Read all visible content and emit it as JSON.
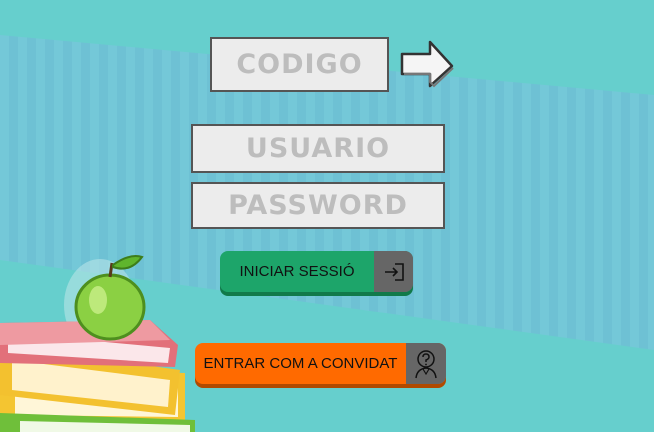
{
  "colors": {
    "background": "#6acfcf",
    "stripe": "#72c3d6",
    "field_bg": "#ececec",
    "login_green": "#1da56a",
    "guest_orange": "#ff6a00",
    "icon_gray": "#666666"
  },
  "form": {
    "codigo_placeholder": "CODIGO",
    "usuario_placeholder": "USUARIO",
    "password_placeholder": "PASSWORD"
  },
  "buttons": {
    "login_label": "INICIAR SESSIÓ",
    "login_icon": "login-icon",
    "guest_label": "ENTRAR COM A CONVIDAT",
    "guest_icon": "guest-question-icon",
    "code_submit_icon": "arrow-right-icon"
  },
  "decoration": {
    "illustration": "books-and-apple-illustration"
  }
}
